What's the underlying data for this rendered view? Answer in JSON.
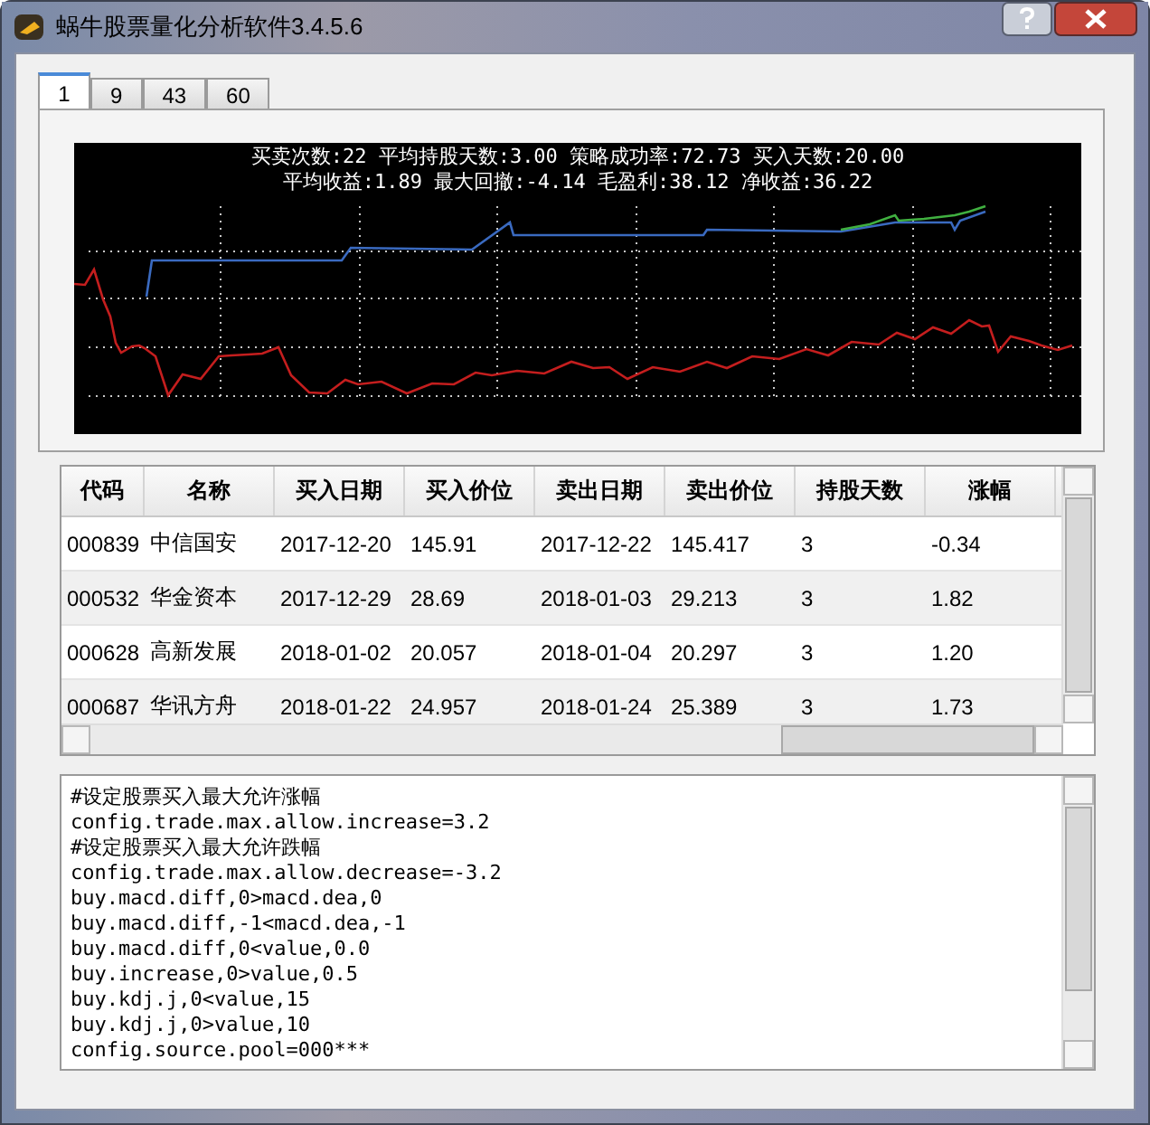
{
  "window": {
    "title": "蜗牛股票量化分析软件3.4.5.6"
  },
  "tabs": [
    {
      "label": "1",
      "selected": true
    },
    {
      "label": "9",
      "selected": false
    },
    {
      "label": "43",
      "selected": false
    },
    {
      "label": "60",
      "selected": false
    }
  ],
  "chart_panel": {
    "stats_lines": [
      "买卖次数:22 平均持股天数:3.00 策略成功率:72.73 买入天数:20.00",
      "平均收益:1.89 最大回撤:-4.14 毛盈利:38.12 净收益:36.22"
    ]
  },
  "table": {
    "columns": [
      "代码",
      "名称",
      "买入日期",
      "买入价位",
      "卖出日期",
      "卖出价位",
      "持股天数",
      "涨幅"
    ],
    "rows": [
      [
        "000839",
        "中信国安",
        "2017-12-20",
        "145.91",
        "2017-12-22",
        "145.417",
        "3",
        "-0.34"
      ],
      [
        "000532",
        "华金资本",
        "2017-12-29",
        "28.69",
        "2018-01-03",
        "29.213",
        "3",
        "1.82"
      ],
      [
        "000628",
        "高新发展",
        "2018-01-02",
        "20.057",
        "2018-01-04",
        "20.297",
        "3",
        "1.20"
      ],
      [
        "000687",
        "华讯方舟",
        "2018-01-22",
        "24.957",
        "2018-01-24",
        "25.389",
        "3",
        "1.73"
      ]
    ]
  },
  "script_editor": {
    "lines": [
      "#设定股票买入最大允许涨幅",
      "config.trade.max.allow.increase=3.2",
      "#设定股票买入最大允许跌幅",
      "config.trade.max.allow.decrease=-3.2",
      "buy.macd.diff,0>macd.dea,0",
      "buy.macd.diff,-1<macd.dea,-1",
      "buy.macd.diff,0<value,0.0",
      "buy.increase,0>value,0.5",
      "buy.kdj.j,0<value,15",
      "buy.kdj.j,0>value,10",
      "config.source.pool=000***"
    ]
  }
}
